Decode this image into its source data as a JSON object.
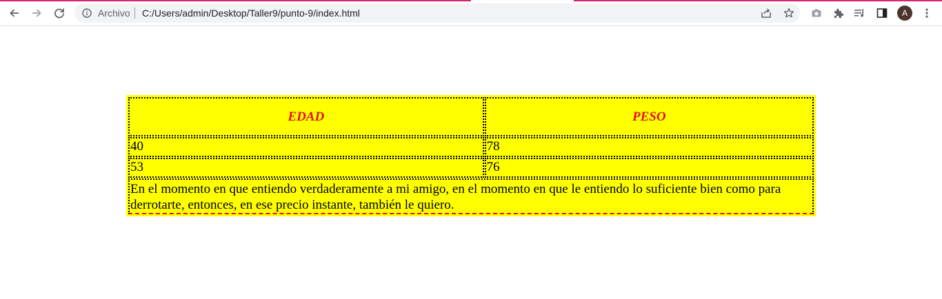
{
  "browser": {
    "site_label": "Archivo",
    "url": "C:/Users/admin/Desktop/Taller9/punto-9/index.html",
    "avatar_letter": "A",
    "tab_accent_color": "#d6246e",
    "icons": {
      "back": "arrow-left-icon",
      "forward": "arrow-right-icon",
      "reload": "reload-icon",
      "info": "info-icon",
      "share": "share-icon",
      "bookmark": "star-icon",
      "screenshot": "camera-icon",
      "extensions": "puzzle-icon",
      "reading_list": "reading-list-icon",
      "side_panel": "side-panel-icon",
      "menu": "kebab-menu-icon"
    }
  },
  "table": {
    "background_color": "#ffff00",
    "header_color": "#e0101a",
    "headers": [
      "EDAD",
      "PESO"
    ],
    "rows": [
      [
        "40",
        "78"
      ],
      [
        "53",
        "76"
      ]
    ],
    "quote": "En el momento en que entiendo verdaderamente a mi amigo, en el momento en que le entiendo lo suficiente bien como para derrotarte, entonces, en ese precio instante, también le quiero."
  }
}
